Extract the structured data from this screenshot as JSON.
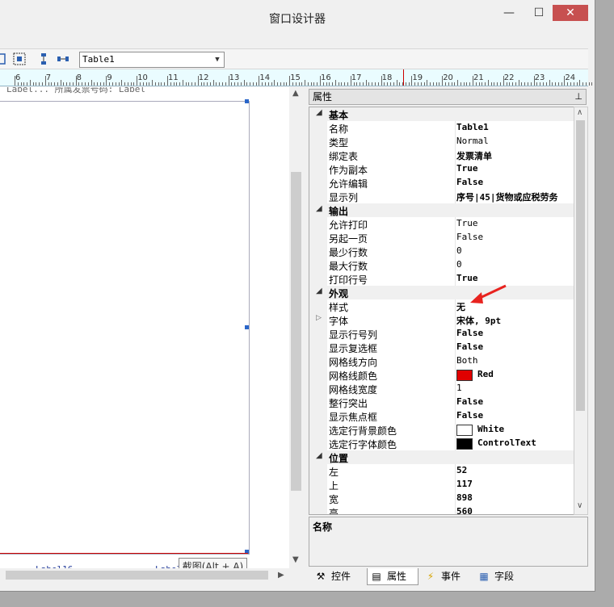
{
  "window": {
    "title": "窗口设计器",
    "minimize": "—",
    "maximize": "☐",
    "close": "✕"
  },
  "toolbar": {
    "combo_value": "Table1"
  },
  "ruler": {
    "labels": [
      "6",
      "7",
      "8",
      "9",
      "10",
      "11",
      "12",
      "13",
      "14",
      "15",
      "16",
      "17",
      "18",
      "19",
      "20",
      "21",
      "22",
      "23",
      "24"
    ]
  },
  "canvas": {
    "top_cut_text": "Label... 所属发票号码: Label",
    "label16": "Label16",
    "label17": "Label17",
    "tooltip": "截图(Alt + A)"
  },
  "properties": {
    "header": "属性",
    "pin": "ᵖ",
    "rows": [
      {
        "kind": "cat",
        "name": "基本"
      },
      {
        "kind": "prop",
        "name": "名称",
        "value": "Table1",
        "bold": true
      },
      {
        "kind": "prop",
        "name": "类型",
        "value": "Normal",
        "bold": false
      },
      {
        "kind": "prop",
        "name": "绑定表",
        "value": "发票清单",
        "bold": true
      },
      {
        "kind": "prop",
        "name": "作为副本",
        "value": "True",
        "bold": true
      },
      {
        "kind": "prop",
        "name": "允许编辑",
        "value": "False",
        "bold": true
      },
      {
        "kind": "prop",
        "name": "显示列",
        "value": "序号|45|货物或应税劳务",
        "bold": true
      },
      {
        "kind": "cat",
        "name": "输出"
      },
      {
        "kind": "prop",
        "name": "允许打印",
        "value": "True",
        "bold": false
      },
      {
        "kind": "prop",
        "name": "另起一页",
        "value": "False",
        "bold": false
      },
      {
        "kind": "prop",
        "name": "最少行数",
        "value": "0",
        "bold": false
      },
      {
        "kind": "prop",
        "name": "最大行数",
        "value": "0",
        "bold": false
      },
      {
        "kind": "prop",
        "name": "打印行号",
        "value": "True",
        "bold": true
      },
      {
        "kind": "cat",
        "name": "外观"
      },
      {
        "kind": "prop",
        "name": "样式",
        "value": "无",
        "bold": true
      },
      {
        "kind": "prop",
        "name": "字体",
        "value": "宋体, 9pt",
        "bold": true,
        "expand": true
      },
      {
        "kind": "prop",
        "name": "显示行号列",
        "value": "False",
        "bold": true
      },
      {
        "kind": "prop",
        "name": "显示复选框",
        "value": "False",
        "bold": true
      },
      {
        "kind": "prop",
        "name": "网格线方向",
        "value": "Both",
        "bold": false
      },
      {
        "kind": "prop",
        "name": "网格线颜色",
        "value": "Red",
        "bold": true,
        "swatch": "#e00000"
      },
      {
        "kind": "prop",
        "name": "网格线宽度",
        "value": "1",
        "bold": false
      },
      {
        "kind": "prop",
        "name": "整行突出",
        "value": "False",
        "bold": true
      },
      {
        "kind": "prop",
        "name": "显示焦点框",
        "value": "False",
        "bold": true
      },
      {
        "kind": "prop",
        "name": "选定行背景颜色",
        "value": "White",
        "bold": true,
        "swatch": "#ffffff"
      },
      {
        "kind": "prop",
        "name": "选定行字体颜色",
        "value": "ControlText",
        "bold": true,
        "swatch": "#000000"
      },
      {
        "kind": "cat",
        "name": "位置"
      },
      {
        "kind": "prop",
        "name": "左",
        "value": "52",
        "bold": true
      },
      {
        "kind": "prop",
        "name": "上",
        "value": "117",
        "bold": true
      },
      {
        "kind": "prop",
        "name": "宽",
        "value": "898",
        "bold": true
      },
      {
        "kind": "prop",
        "name": "高",
        "value": "560",
        "bold": true
      }
    ],
    "description_title": "名称"
  },
  "tabs": [
    {
      "label": "控件",
      "icon": "wrench-icon",
      "glyph": "⚒"
    },
    {
      "label": "属性",
      "icon": "properties-icon",
      "glyph": "▤"
    },
    {
      "label": "事件",
      "icon": "lightning-icon",
      "glyph": "⚡"
    },
    {
      "label": "字段",
      "icon": "fields-icon",
      "glyph": "▦"
    }
  ],
  "colors": {
    "annotation_arrow": "#e8231f",
    "close_button": "#c75050"
  }
}
